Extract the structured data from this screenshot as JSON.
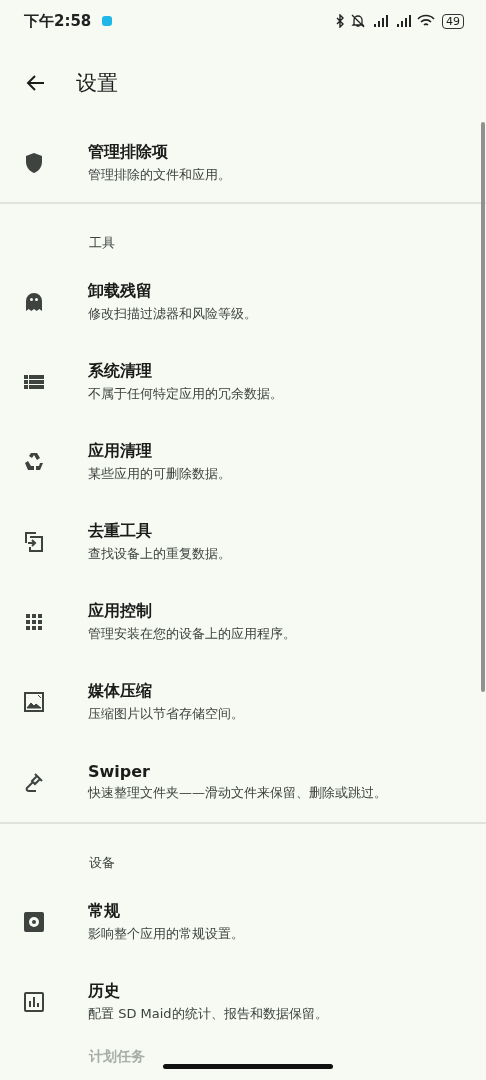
{
  "status_bar": {
    "time": "下午2:58",
    "battery": "49"
  },
  "toolbar": {
    "title": "设置"
  },
  "sections": [
    {
      "items": [
        {
          "kind": "shield",
          "title": "管理排除项",
          "subtitle": "管理排除的文件和应用。"
        }
      ]
    },
    {
      "header": "工具",
      "items": [
        {
          "kind": "ghost",
          "title": "卸载残留",
          "subtitle": "修改扫描过滤器和风险等级。"
        },
        {
          "kind": "list",
          "title": "系统清理",
          "subtitle": "不属于任何特定应用的冗余数据。"
        },
        {
          "kind": "recycle",
          "title": "应用清理",
          "subtitle": "某些应用的可删除数据。"
        },
        {
          "kind": "dedupe",
          "title": "去重工具",
          "subtitle": "查找设备上的重复数据。"
        },
        {
          "kind": "grid",
          "title": "应用控制",
          "subtitle": "管理安装在您的设备上的应用程序。"
        },
        {
          "kind": "image",
          "title": "媒体压缩",
          "subtitle": "压缩图片以节省存储空间。"
        },
        {
          "kind": "swiper",
          "title": "Swiper",
          "subtitle": "快速整理文件夹——滑动文件来保留、删除或跳过。"
        }
      ]
    },
    {
      "header": "设备",
      "items": [
        {
          "kind": "gear",
          "title": "常规",
          "subtitle": "影响整个应用的常规设置。"
        },
        {
          "kind": "chart",
          "title": "历史",
          "subtitle": "配置 SD Maid的统计、报告和数据保留。"
        }
      ]
    }
  ],
  "partial_item": {
    "title": "计划任务"
  }
}
